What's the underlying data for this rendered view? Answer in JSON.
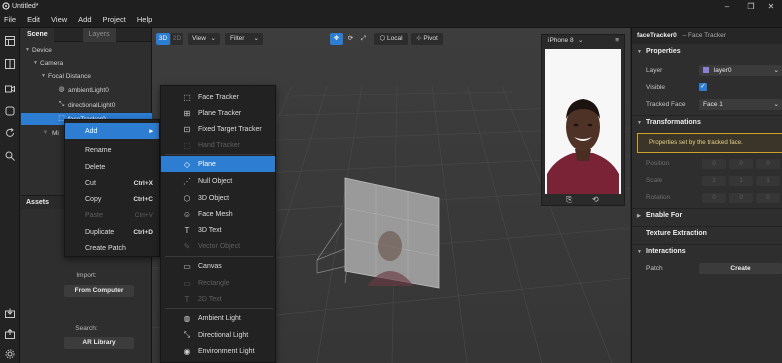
{
  "window": {
    "title": "Untitled*"
  },
  "menu": [
    "File",
    "Edit",
    "View",
    "Add",
    "Project",
    "Help"
  ],
  "scene_panel": {
    "tabs": [
      "Scene",
      "Layers"
    ],
    "tree": [
      {
        "label": "Device"
      },
      {
        "label": "Camera"
      },
      {
        "label": "Focal Distance"
      },
      {
        "label": "ambientLight0"
      },
      {
        "label": "directionalLight0"
      },
      {
        "label": "faceTracker0"
      },
      {
        "label": "Mi"
      }
    ]
  },
  "assets": {
    "header": "Assets",
    "import_label": "Import:",
    "import_button": "From Computer",
    "search_label": "Search:",
    "search_button": "AR Library"
  },
  "viewport": {
    "mode_3d": "3D",
    "mode_2d": "2D",
    "view_menu": "View",
    "filter_menu": "Filter",
    "local_button": "Local",
    "pivot_button": "Pivot"
  },
  "preview": {
    "device": "iPhone 8"
  },
  "context_menu": {
    "items": [
      {
        "label": "Add",
        "shortcut": ""
      },
      {
        "label": "Rename",
        "shortcut": ""
      },
      {
        "label": "Delete",
        "shortcut": ""
      },
      {
        "label": "Cut",
        "shortcut": "Ctrl+X"
      },
      {
        "label": "Copy",
        "shortcut": "Ctrl+C"
      },
      {
        "label": "Paste",
        "shortcut": "Ctrl+V"
      },
      {
        "label": "Duplicate",
        "shortcut": "Ctrl+D"
      },
      {
        "label": "Create Patch",
        "shortcut": ""
      }
    ]
  },
  "add_submenu": {
    "items": [
      {
        "label": "Face Tracker"
      },
      {
        "label": "Plane Tracker"
      },
      {
        "label": "Fixed Target Tracker"
      },
      {
        "label": "Hand Tracker"
      },
      {
        "label": "Plane"
      },
      {
        "label": "Null Object"
      },
      {
        "label": "3D Object"
      },
      {
        "label": "Face Mesh"
      },
      {
        "label": "3D Text"
      },
      {
        "label": "Vector Object"
      },
      {
        "label": "Canvas"
      },
      {
        "label": "Rectangle"
      },
      {
        "label": "2D Text"
      },
      {
        "label": "Ambient Light"
      },
      {
        "label": "Directional Light"
      },
      {
        "label": "Environment Light"
      }
    ]
  },
  "inspector": {
    "object_name": "faceTracker0",
    "object_type": "– Face Tracker",
    "properties_header": "Properties",
    "layer_label": "Layer",
    "layer_value": "layer0",
    "visible_label": "Visible",
    "tracked_face_label": "Tracked Face",
    "tracked_face_value": "Face 1",
    "transformations_header": "Transformations",
    "transform_note": "Properties set by the tracked face.",
    "position_label": "Position",
    "scale_label": "Scale",
    "rotation_label": "Rotation",
    "numbers": {
      "position": [
        "0",
        "0",
        "0"
      ],
      "scale": [
        "1",
        "1",
        "1"
      ],
      "rotation": [
        "0",
        "0",
        "0"
      ]
    },
    "enable_for_header": "Enable For",
    "texture_header": "Texture Extraction",
    "interactions_header": "Interactions",
    "patch_label": "Patch",
    "create_button": "Create"
  },
  "colors": {
    "accent": "#2d7dd2",
    "note_border": "#c9a227",
    "layer_swatch": "#8b7fd6"
  }
}
